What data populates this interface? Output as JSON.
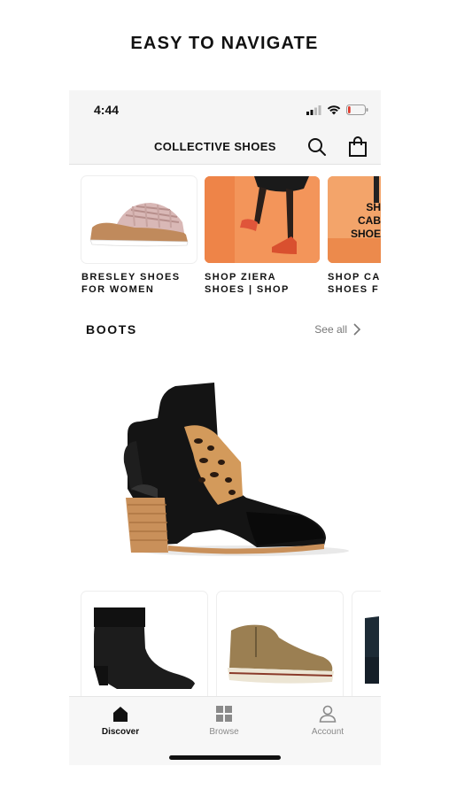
{
  "headline": "EASY TO NAVIGATE",
  "status_bar": {
    "time": "4:44",
    "battery_level": 0.15
  },
  "header": {
    "title": "COLLECTIVE SHOES",
    "search_icon": "search-icon",
    "bag_icon": "shopping-bag-icon"
  },
  "brands": [
    {
      "label_line1": "BRESLEY SHOES",
      "label_line2": "FOR WOMEN"
    },
    {
      "label_line1": "SHOP ZIERA",
      "label_line2": "SHOES | SHOP"
    },
    {
      "label_line1": "SHOP CA",
      "label_line2": "SHOES F",
      "card_text_1": "SH",
      "card_text_2": "CAB",
      "card_text_3": "SHOE"
    }
  ],
  "section": {
    "title": "BOOTS",
    "see_all": "See all"
  },
  "tabs": [
    {
      "label": "Discover",
      "icon": "home-icon",
      "active": true
    },
    {
      "label": "Browse",
      "icon": "grid-icon",
      "active": false
    },
    {
      "label": "Account",
      "icon": "user-icon",
      "active": false
    }
  ],
  "colors": {
    "active_tab": "#111111",
    "inactive_tab": "#8a8a8a",
    "header_bg": "#f5f5f5",
    "promo_orange": "#f08b4f"
  }
}
